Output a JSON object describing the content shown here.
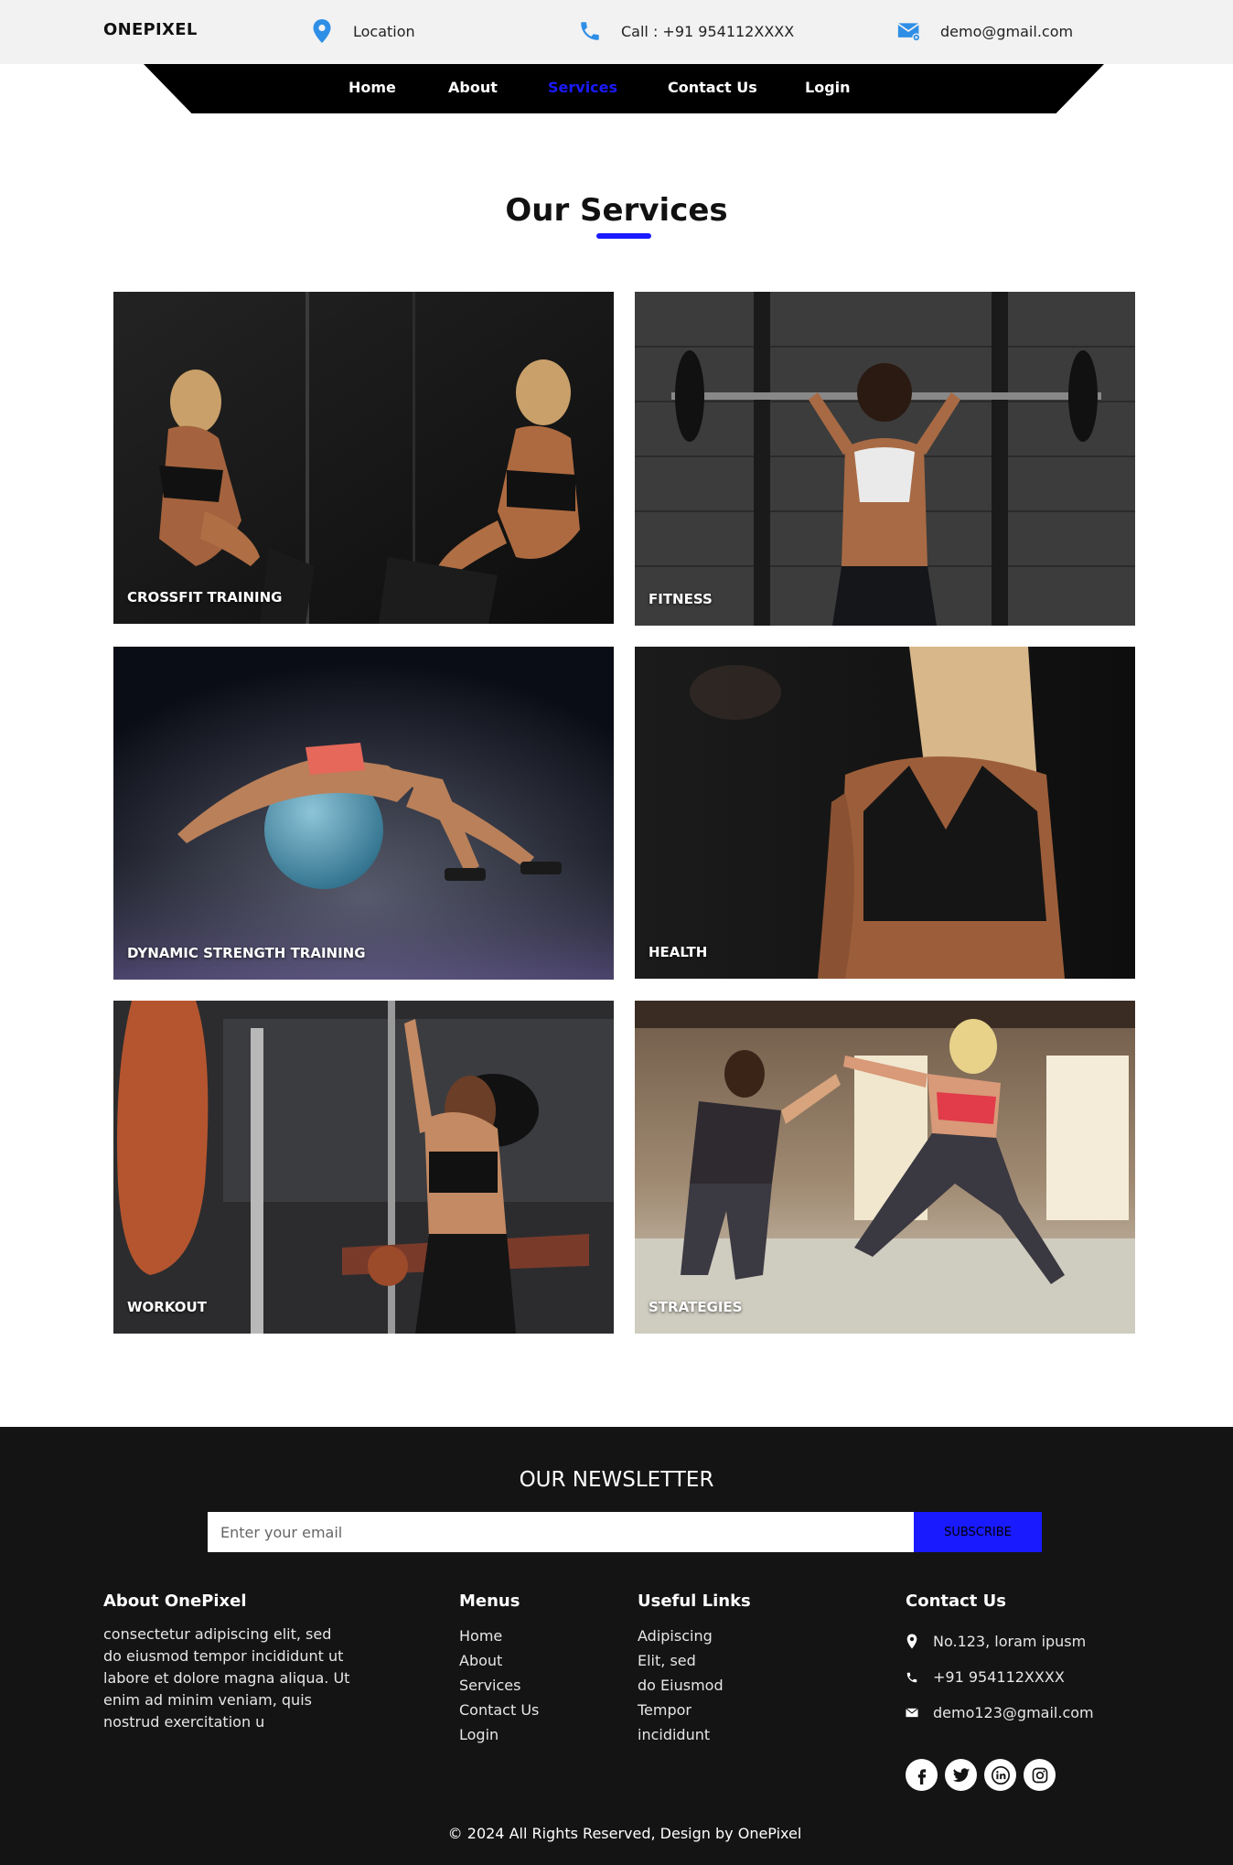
{
  "topbar": {
    "brand": "ONEPIXEL",
    "location_label": "Location",
    "call_label": "Call : +91 954112XXXX",
    "email_label": "demo@gmail.com",
    "icon_color": "#2f8fe6"
  },
  "nav": {
    "items": [
      "Home",
      "About",
      "Services",
      "Contact Us",
      "Login"
    ],
    "active": "Services"
  },
  "services": {
    "title": "Our Services",
    "accent": "#1a1aff",
    "cards": [
      {
        "label": "CROSSFIT TRAINING"
      },
      {
        "label": "FITNESS"
      },
      {
        "label": "DYNAMIC STRENGTH TRAINING"
      },
      {
        "label": "HEALTH"
      },
      {
        "label": "WORKOUT"
      },
      {
        "label": "STRATEGIES"
      }
    ]
  },
  "newsletter": {
    "title": "OUR NEWSLETTER",
    "placeholder": "Enter your email",
    "button": "SUBSCRIBE"
  },
  "footer": {
    "about_title": "About OnePixel",
    "about_text": "consectetur adipiscing elit, sed do eiusmod tempor incididunt ut labore et dolore magna aliqua. Ut enim ad minim veniam, quis nostrud exercitation u",
    "menus_title": "Menus",
    "menus": [
      "Home",
      "About",
      "Services",
      "Contact Us",
      "Login"
    ],
    "links_title": "Useful Links",
    "links": [
      "Adipiscing",
      "Elit, sed",
      "do Eiusmod",
      "Tempor",
      "incididunt"
    ],
    "contact_title": "Contact Us",
    "address": "No.123, loram ipusm",
    "phone": "+91 954112XXXX",
    "email": "demo123@gmail.com",
    "socials": [
      "facebook-icon",
      "twitter-icon",
      "linkedin-icon",
      "instagram-icon"
    ],
    "copyright": "© 2024 All Rights Reserved, Design by OnePixel"
  }
}
